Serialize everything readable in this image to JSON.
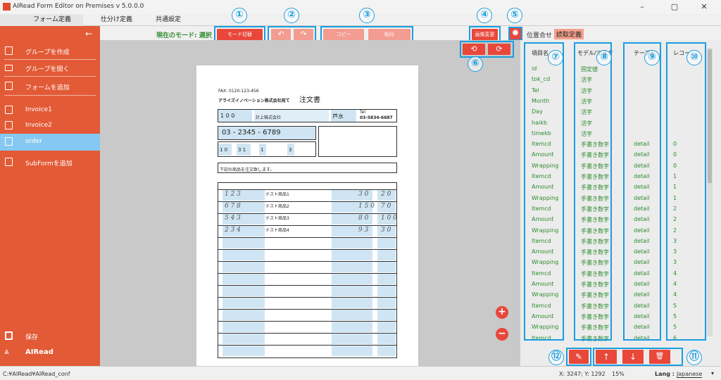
{
  "window": {
    "title": "AIRead Form Editor on Premises v 5.0.0.0",
    "minimize": "–",
    "maximize": "▢",
    "close": "✕"
  },
  "menu_tabs": [
    "フォーム定義",
    "仕分け定義",
    "共通設定"
  ],
  "sidebar": {
    "back_arrow": "←",
    "items": [
      {
        "label": "グループを作成",
        "icon": "plus-box-icon"
      },
      {
        "label": "グループを開く",
        "icon": "folder-open-icon"
      },
      {
        "label": "フォームを追加",
        "icon": "plus-box-icon"
      },
      {
        "label": "Invoice1",
        "icon": "document-icon"
      },
      {
        "label": "Invoice2",
        "icon": "document-icon"
      },
      {
        "label": "order",
        "icon": "document-icon",
        "active": true
      },
      {
        "label": "SubFormを追加",
        "icon": "plus-box-icon"
      }
    ],
    "save_label": "保存",
    "brand": "AIRead"
  },
  "toolbar": {
    "mode_label": "現在のモード: 選択",
    "mode_switch_button": "モード切替",
    "undo": "↶",
    "redo": "↷",
    "copy_button": "コピー",
    "paste_button": "貼付",
    "image_change_button": "画像変更",
    "rotate_left": "⟲",
    "rotate_right": "⟳",
    "zoom_in": "+",
    "zoom_out": "−"
  },
  "callouts": [
    "①",
    "②",
    "③",
    "④",
    "⑤",
    "⑥",
    "⑦",
    "⑧",
    "⑨",
    "⑩",
    "⑪",
    "⑫"
  ],
  "right_panel": {
    "tabs": [
      "位置合せ",
      "読取定義"
    ],
    "headers": [
      "項目名",
      "モデル/マスター",
      "テーブル",
      "レコード"
    ],
    "rows": [
      [
        "id",
        "固定値",
        "",
        ""
      ],
      [
        "tok_cd",
        "活字",
        "",
        ""
      ],
      [
        "Tel",
        "活字",
        "",
        ""
      ],
      [
        "Month",
        "活字",
        "",
        ""
      ],
      [
        "Day",
        "活字",
        "",
        ""
      ],
      [
        "haikb",
        "活字",
        "",
        ""
      ],
      [
        "timekb",
        "活字",
        "",
        ""
      ],
      [
        "Itemcd",
        "手書き数字",
        "detail",
        "0"
      ],
      [
        "Amount",
        "手書き数字",
        "detail",
        "0"
      ],
      [
        "Wrapping",
        "手書き数字",
        "detail",
        "0"
      ],
      [
        "Itemcd",
        "手書き数字",
        "detail",
        "1"
      ],
      [
        "Amount",
        "手書き数字",
        "detail",
        "1"
      ],
      [
        "Wrapping",
        "手書き数字",
        "detail",
        "1"
      ],
      [
        "Itemcd",
        "手書き数字",
        "detail",
        "2"
      ],
      [
        "Amount",
        "手書き数字",
        "detail",
        "2"
      ],
      [
        "Wrapping",
        "手書き数字",
        "detail",
        "2"
      ],
      [
        "Itemcd",
        "手書き数字",
        "detail",
        "3"
      ],
      [
        "Amount",
        "手書き数字",
        "detail",
        "3"
      ],
      [
        "Wrapping",
        "手書き数字",
        "detail",
        "3"
      ],
      [
        "Itemcd",
        "手書き数字",
        "detail",
        "4"
      ],
      [
        "Amount",
        "手書き数字",
        "detail",
        "4"
      ],
      [
        "Wrapping",
        "手書き数字",
        "detail",
        "4"
      ],
      [
        "Itemcd",
        "手書き数字",
        "detail",
        "5"
      ],
      [
        "Amount",
        "手書き数字",
        "detail",
        "5"
      ],
      [
        "Wrapping",
        "手書き数字",
        "detail",
        "5"
      ],
      [
        "Itemcd",
        "手書き数字",
        "detail",
        "6"
      ]
    ],
    "buttons": {
      "edit": "✎",
      "up": "↑",
      "down": "↓",
      "delete": "🗑"
    }
  },
  "document": {
    "fax": "FAX: 0120-123-456",
    "title": "注文書",
    "company": "アライズイノベーション株式会社宛て",
    "cust_code": "1 0 0",
    "cust_name": "計上株式会社",
    "person": "芦水",
    "tel_label": "Tel",
    "tel_right": "03-5834-6687",
    "phone": "03 - 2345 - 6789",
    "month": "1 0",
    "day": "3 1",
    "code1": "1",
    "code2": "3",
    "note": "下記の商品を注文致します。",
    "items": [
      {
        "code": "1 2 3",
        "name": "テスト商品1",
        "qty": "3 0",
        "wrap": "2 0"
      },
      {
        "code": "6 7 8",
        "name": "テスト商品2",
        "qty": "1 5 0",
        "wrap": "7 0"
      },
      {
        "code": "5 4 3",
        "name": "テスト商品3",
        "qty": "8 0",
        "wrap": "1 0 0"
      },
      {
        "code": "2 3 4",
        "name": "テスト商品4",
        "qty": "9 3",
        "wrap": "3 0"
      }
    ]
  },
  "status": {
    "path": "C:¥AIRead¥AIRead_conf",
    "coords": "X: 3247; Y: 1292",
    "zoom": "15%",
    "lang_label": "Lang :",
    "lang_value": "Japanese"
  }
}
